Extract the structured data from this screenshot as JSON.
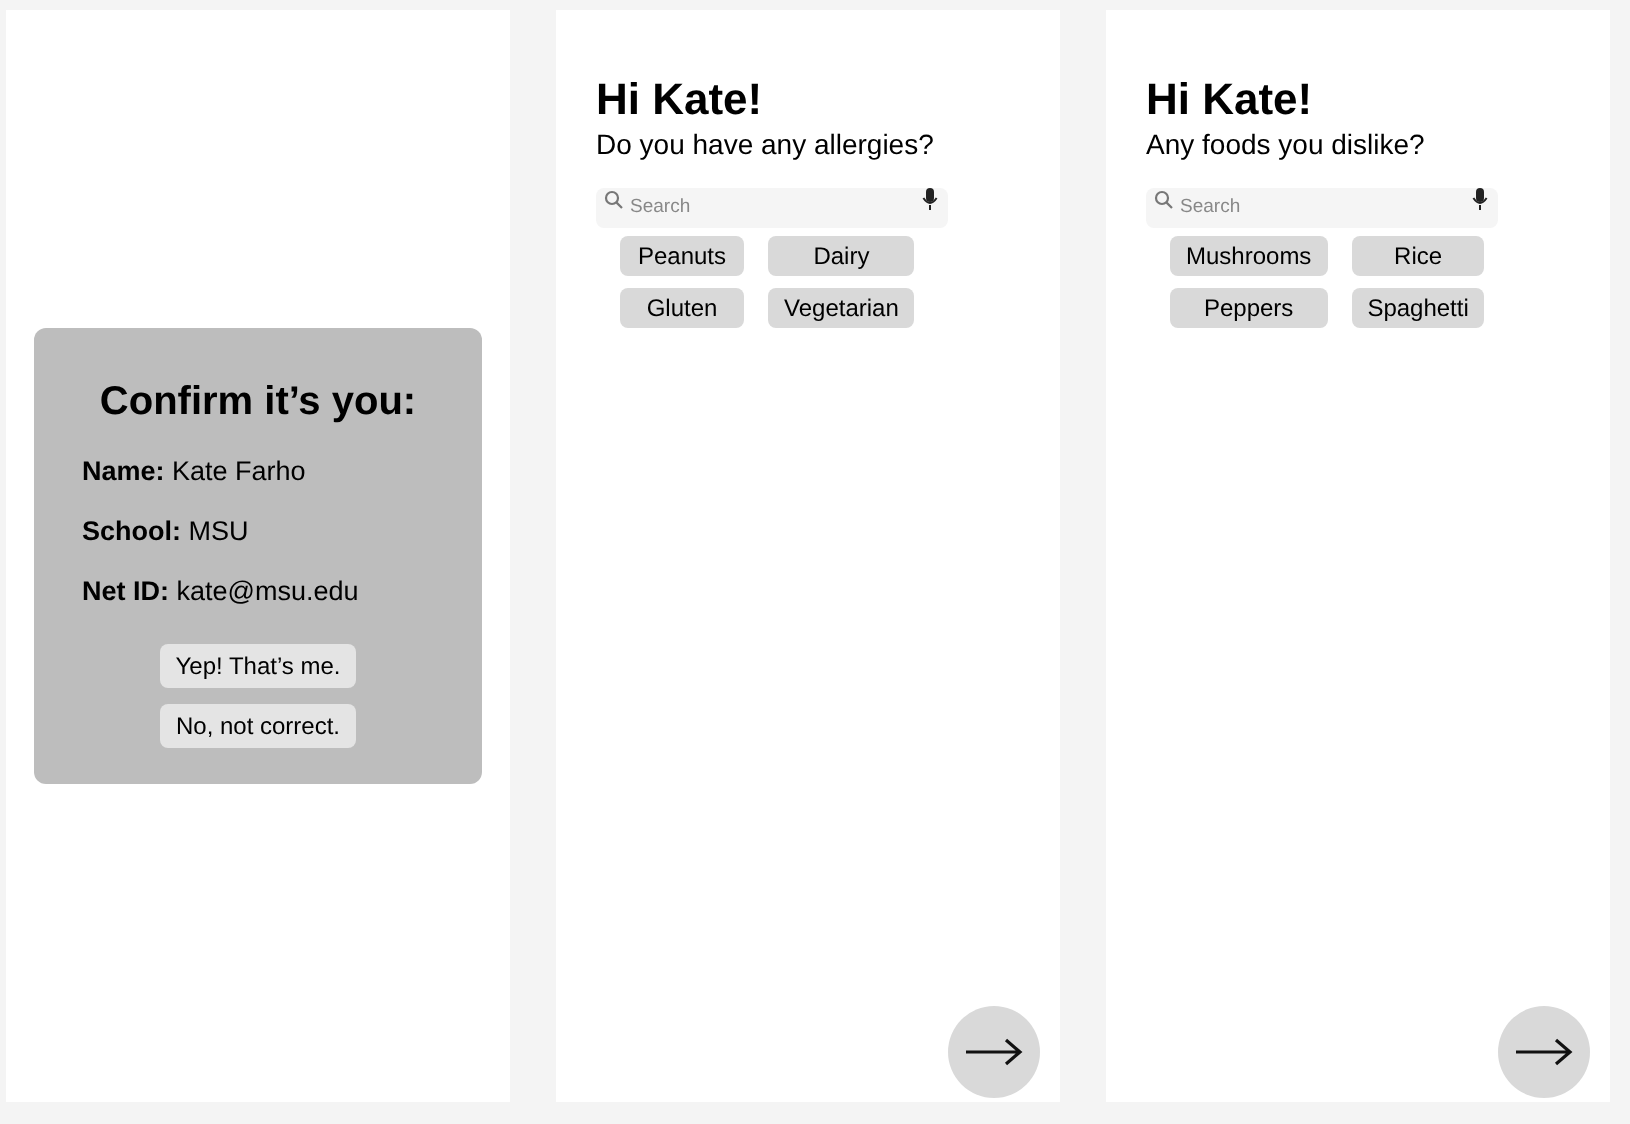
{
  "screens": [
    {
      "kind": "confirm",
      "title": "Confirm it’s you:",
      "fields": [
        {
          "label": "Name:",
          "value": "Kate Farho"
        },
        {
          "label": "School:",
          "value": "MSU"
        },
        {
          "label": "Net ID:",
          "value": "kate@msu.edu"
        }
      ],
      "buttons": [
        "Yep! That’s me.",
        "No, not correct."
      ]
    },
    {
      "kind": "question",
      "greeting": "Hi Kate!",
      "question": "Do you have any allergies?",
      "search": {
        "placeholder": "Search"
      },
      "chips": [
        "Peanuts",
        "Dairy",
        "Gluten",
        "Vegetarian"
      ]
    },
    {
      "kind": "question",
      "greeting": "Hi Kate!",
      "question": "Any foods you dislike?",
      "search": {
        "placeholder": "Search"
      },
      "chips": [
        "Mushrooms",
        "Rice",
        "Peppers",
        "Spaghetti"
      ]
    }
  ]
}
